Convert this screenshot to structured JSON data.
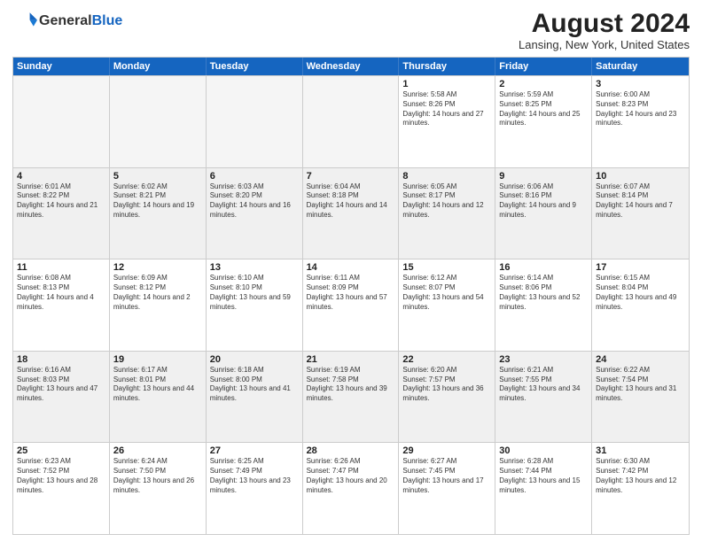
{
  "logo": {
    "general": "General",
    "blue": "Blue"
  },
  "header": {
    "month": "August 2024",
    "location": "Lansing, New York, United States"
  },
  "days": [
    "Sunday",
    "Monday",
    "Tuesday",
    "Wednesday",
    "Thursday",
    "Friday",
    "Saturday"
  ],
  "weeks": [
    [
      {
        "day": "",
        "empty": true
      },
      {
        "day": "",
        "empty": true
      },
      {
        "day": "",
        "empty": true
      },
      {
        "day": "",
        "empty": true
      },
      {
        "day": "1",
        "sunrise": "5:58 AM",
        "sunset": "8:26 PM",
        "daylight": "14 hours and 27 minutes."
      },
      {
        "day": "2",
        "sunrise": "5:59 AM",
        "sunset": "8:25 PM",
        "daylight": "14 hours and 25 minutes."
      },
      {
        "day": "3",
        "sunrise": "6:00 AM",
        "sunset": "8:23 PM",
        "daylight": "14 hours and 23 minutes."
      }
    ],
    [
      {
        "day": "4",
        "sunrise": "6:01 AM",
        "sunset": "8:22 PM",
        "daylight": "14 hours and 21 minutes."
      },
      {
        "day": "5",
        "sunrise": "6:02 AM",
        "sunset": "8:21 PM",
        "daylight": "14 hours and 19 minutes."
      },
      {
        "day": "6",
        "sunrise": "6:03 AM",
        "sunset": "8:20 PM",
        "daylight": "14 hours and 16 minutes."
      },
      {
        "day": "7",
        "sunrise": "6:04 AM",
        "sunset": "8:18 PM",
        "daylight": "14 hours and 14 minutes."
      },
      {
        "day": "8",
        "sunrise": "6:05 AM",
        "sunset": "8:17 PM",
        "daylight": "14 hours and 12 minutes."
      },
      {
        "day": "9",
        "sunrise": "6:06 AM",
        "sunset": "8:16 PM",
        "daylight": "14 hours and 9 minutes."
      },
      {
        "day": "10",
        "sunrise": "6:07 AM",
        "sunset": "8:14 PM",
        "daylight": "14 hours and 7 minutes."
      }
    ],
    [
      {
        "day": "11",
        "sunrise": "6:08 AM",
        "sunset": "8:13 PM",
        "daylight": "14 hours and 4 minutes."
      },
      {
        "day": "12",
        "sunrise": "6:09 AM",
        "sunset": "8:12 PM",
        "daylight": "14 hours and 2 minutes."
      },
      {
        "day": "13",
        "sunrise": "6:10 AM",
        "sunset": "8:10 PM",
        "daylight": "13 hours and 59 minutes."
      },
      {
        "day": "14",
        "sunrise": "6:11 AM",
        "sunset": "8:09 PM",
        "daylight": "13 hours and 57 minutes."
      },
      {
        "day": "15",
        "sunrise": "6:12 AM",
        "sunset": "8:07 PM",
        "daylight": "13 hours and 54 minutes."
      },
      {
        "day": "16",
        "sunrise": "6:14 AM",
        "sunset": "8:06 PM",
        "daylight": "13 hours and 52 minutes."
      },
      {
        "day": "17",
        "sunrise": "6:15 AM",
        "sunset": "8:04 PM",
        "daylight": "13 hours and 49 minutes."
      }
    ],
    [
      {
        "day": "18",
        "sunrise": "6:16 AM",
        "sunset": "8:03 PM",
        "daylight": "13 hours and 47 minutes."
      },
      {
        "day": "19",
        "sunrise": "6:17 AM",
        "sunset": "8:01 PM",
        "daylight": "13 hours and 44 minutes."
      },
      {
        "day": "20",
        "sunrise": "6:18 AM",
        "sunset": "8:00 PM",
        "daylight": "13 hours and 41 minutes."
      },
      {
        "day": "21",
        "sunrise": "6:19 AM",
        "sunset": "7:58 PM",
        "daylight": "13 hours and 39 minutes."
      },
      {
        "day": "22",
        "sunrise": "6:20 AM",
        "sunset": "7:57 PM",
        "daylight": "13 hours and 36 minutes."
      },
      {
        "day": "23",
        "sunrise": "6:21 AM",
        "sunset": "7:55 PM",
        "daylight": "13 hours and 34 minutes."
      },
      {
        "day": "24",
        "sunrise": "6:22 AM",
        "sunset": "7:54 PM",
        "daylight": "13 hours and 31 minutes."
      }
    ],
    [
      {
        "day": "25",
        "sunrise": "6:23 AM",
        "sunset": "7:52 PM",
        "daylight": "13 hours and 28 minutes."
      },
      {
        "day": "26",
        "sunrise": "6:24 AM",
        "sunset": "7:50 PM",
        "daylight": "13 hours and 26 minutes."
      },
      {
        "day": "27",
        "sunrise": "6:25 AM",
        "sunset": "7:49 PM",
        "daylight": "13 hours and 23 minutes."
      },
      {
        "day": "28",
        "sunrise": "6:26 AM",
        "sunset": "7:47 PM",
        "daylight": "13 hours and 20 minutes."
      },
      {
        "day": "29",
        "sunrise": "6:27 AM",
        "sunset": "7:45 PM",
        "daylight": "13 hours and 17 minutes."
      },
      {
        "day": "30",
        "sunrise": "6:28 AM",
        "sunset": "7:44 PM",
        "daylight": "13 hours and 15 minutes."
      },
      {
        "day": "31",
        "sunrise": "6:30 AM",
        "sunset": "7:42 PM",
        "daylight": "13 hours and 12 minutes."
      }
    ]
  ]
}
